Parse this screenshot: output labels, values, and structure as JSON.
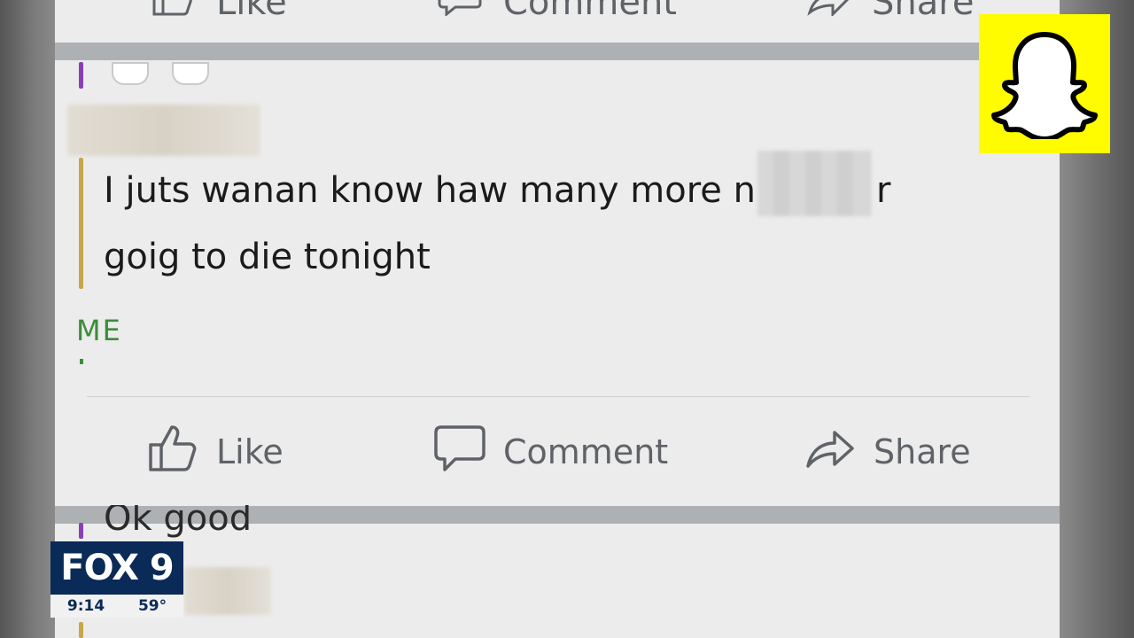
{
  "post": {
    "message_line1": "I juts wanan know haw many more n",
    "message_tail": "r",
    "message_line2": "goig to die tonight",
    "sender_label": "ME",
    "partial_next_message": "Ok good"
  },
  "actions": {
    "like": "Like",
    "comment": "Comment",
    "share": "Share"
  },
  "top_actions": {
    "like": "Like",
    "comment": "Comment",
    "share": "Share"
  },
  "broadcast": {
    "station": "FOX 9",
    "time": "9:14",
    "temperature": "59°"
  },
  "icons": {
    "like": "thumbs-up-icon",
    "comment": "comment-bubble-icon",
    "share": "share-arrow-icon",
    "snapchat": "snapchat-ghost-logo"
  },
  "colors": {
    "snapchat_yellow": "#fffc00",
    "fox_navy": "#0a2a57",
    "sender_green": "#3a8e3a",
    "quote_bar_gold": "#c8a54a",
    "quote_bar_purple": "#8a3fb5"
  }
}
